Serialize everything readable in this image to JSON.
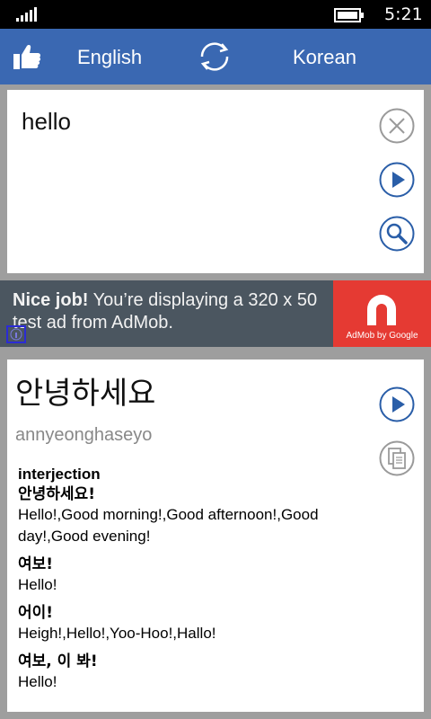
{
  "status_bar": {
    "time": "5:21"
  },
  "header": {
    "source_language": "English",
    "target_language": "Korean",
    "accent_color": "#3a68b2"
  },
  "input": {
    "text": "hello",
    "clear_icon": "close-icon",
    "play_icon": "play-icon",
    "search_icon": "search-icon"
  },
  "ad": {
    "bold": "Nice job!",
    "text": " You’re displaying a 320 x 50 test ad from AdMob.",
    "logo_text": "AdMob by Google",
    "logo_color": "#e53a33"
  },
  "result": {
    "translation": "안녕하세요",
    "romanization": "annyeonghaseyo",
    "part_of_speech": "interjection",
    "entries": [
      {
        "term": "안녕하세요!",
        "definition": "Hello!,Good morning!,Good afternoon!,Good day!,Good evening!"
      },
      {
        "term": "여보!",
        "definition": "Hello!"
      },
      {
        "term": "어이!",
        "definition": "Heigh!,Hello!,Yoo-Hoo!,Hallo!"
      },
      {
        "term": "여보, 이 봐!",
        "definition": "Hello!"
      }
    ]
  }
}
